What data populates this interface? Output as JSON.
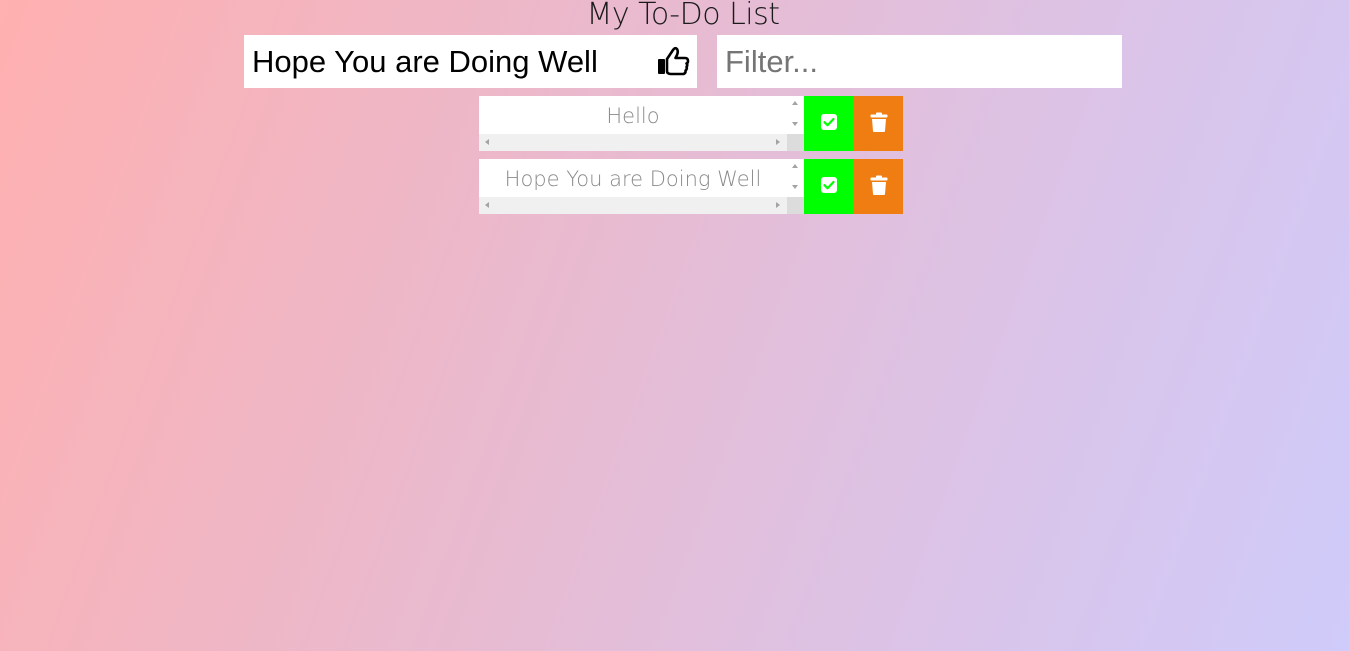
{
  "header": {
    "title": "My To-Do List"
  },
  "form": {
    "todo_input_value": "Hope You are Doing Well",
    "add_button_icon": "thumbs-up-icon",
    "filter_placeholder": "Filter..."
  },
  "todos": [
    {
      "text": "Hello"
    },
    {
      "text": "Hope You are Doing Well"
    }
  ],
  "icons": {
    "complete": "check-square-icon",
    "delete": "trash-icon"
  },
  "colors": {
    "complete_button": "#00ff00",
    "delete_button": "#ef7d12",
    "gradient_left": "#ffb0b0",
    "gradient_right": "#cfcbfa"
  }
}
